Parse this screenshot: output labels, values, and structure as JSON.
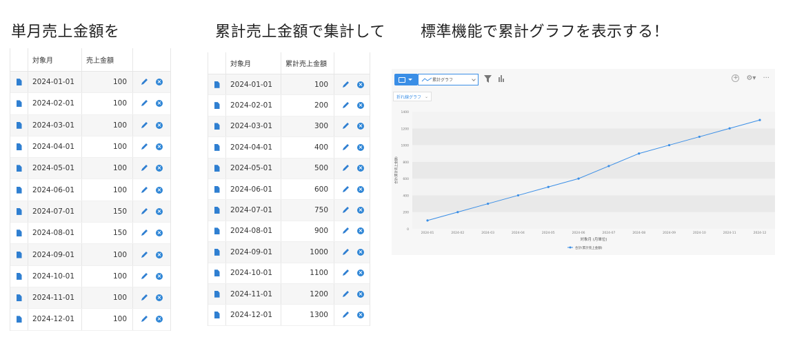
{
  "headings": {
    "h1": "単月売上金額を",
    "h2": "累計売上金額で集計して",
    "h3": "標準機能で累計グラフを表示する！"
  },
  "monthly_table": {
    "columns": [
      "対象月",
      "売上金額"
    ],
    "rows": [
      {
        "month": "2024-01-01",
        "amount": "100"
      },
      {
        "month": "2024-02-01",
        "amount": "100"
      },
      {
        "month": "2024-03-01",
        "amount": "100"
      },
      {
        "month": "2024-04-01",
        "amount": "100"
      },
      {
        "month": "2024-05-01",
        "amount": "100"
      },
      {
        "month": "2024-06-01",
        "amount": "100"
      },
      {
        "month": "2024-07-01",
        "amount": "150"
      },
      {
        "month": "2024-08-01",
        "amount": "150"
      },
      {
        "month": "2024-09-01",
        "amount": "100"
      },
      {
        "month": "2024-10-01",
        "amount": "100"
      },
      {
        "month": "2024-11-01",
        "amount": "100"
      },
      {
        "month": "2024-12-01",
        "amount": "100"
      }
    ]
  },
  "cumulative_table": {
    "columns": [
      "対象月",
      "累計売上金額"
    ],
    "rows": [
      {
        "month": "2024-01-01",
        "amount": "100"
      },
      {
        "month": "2024-02-01",
        "amount": "200"
      },
      {
        "month": "2024-03-01",
        "amount": "300"
      },
      {
        "month": "2024-04-01",
        "amount": "400"
      },
      {
        "month": "2024-05-01",
        "amount": "500"
      },
      {
        "month": "2024-06-01",
        "amount": "600"
      },
      {
        "month": "2024-07-01",
        "amount": "750"
      },
      {
        "month": "2024-08-01",
        "amount": "900"
      },
      {
        "month": "2024-09-01",
        "amount": "1000"
      },
      {
        "month": "2024-10-01",
        "amount": "1100"
      },
      {
        "month": "2024-11-01",
        "amount": "1200"
      },
      {
        "month": "2024-12-01",
        "amount": "1300"
      }
    ]
  },
  "row_icons": {
    "record": "document-icon",
    "edit": "pencil-icon",
    "delete": "close-circle-icon"
  },
  "chart_toolbar": {
    "chart_type_select": "累計グラフ",
    "subtype_select": "折れ線グラフ",
    "icons": [
      "monitor-icon",
      "line-chart-icon",
      "filter-icon",
      "bar-chart-icon",
      "plus-icon",
      "gear-icon",
      "more-icon"
    ]
  },
  "chart_data": {
    "type": "line",
    "categories": [
      "2024-01",
      "2024-02",
      "2024-03",
      "2024-04",
      "2024-05",
      "2024-06",
      "2024-07",
      "2024-08",
      "2024-09",
      "2024-10",
      "2024-11",
      "2024-12"
    ],
    "series": [
      {
        "name": "合計(累計売上金額)",
        "values": [
          100,
          200,
          300,
          400,
          500,
          600,
          750,
          900,
          1000,
          1100,
          1200,
          1300
        ]
      }
    ],
    "xlabel": "対象月 (月単位)",
    "ylabel": "合計(累計売上金額)",
    "ylim": [
      0,
      1400
    ],
    "yticks": [
      0,
      200,
      400,
      600,
      800,
      1000,
      1200,
      1400
    ],
    "grid": true,
    "legend": "bottom",
    "color": "#3a8ee6"
  }
}
